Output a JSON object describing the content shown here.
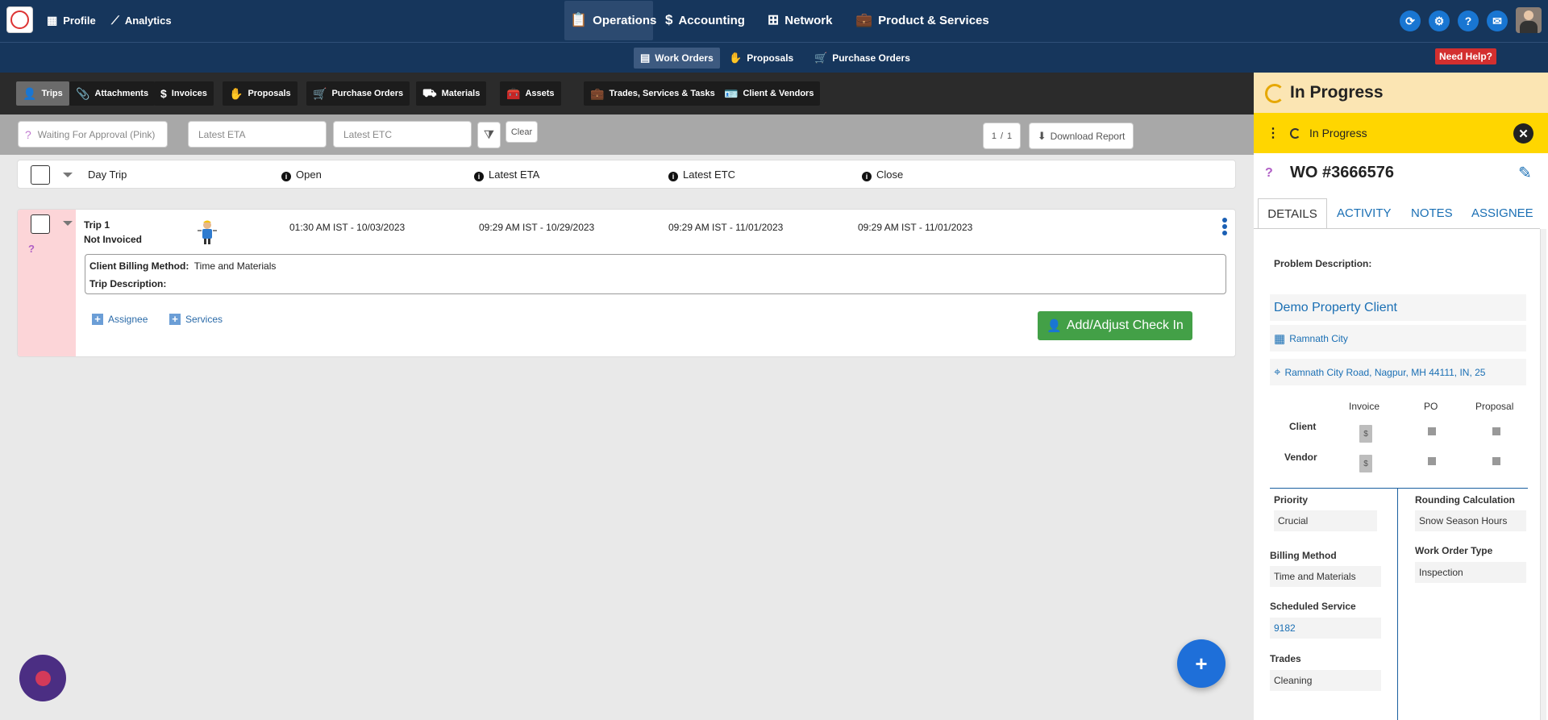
{
  "topnav": {
    "logo_text": "Logo",
    "left_items": [
      {
        "label": "Profile",
        "icon": "building-icon"
      },
      {
        "label": "Analytics",
        "icon": "chart-line-icon"
      }
    ],
    "center_items": [
      {
        "label": "Operations",
        "icon": "clipboard-icon",
        "active": true
      },
      {
        "label": "Accounting",
        "icon": "dollar-box-icon"
      },
      {
        "label": "Network",
        "icon": "network-icon"
      },
      {
        "label": "Product & Services",
        "icon": "briefcase-icon"
      }
    ],
    "right_icons": [
      "sync-icon",
      "gear-icon",
      "help-icon",
      "chat-icon"
    ]
  },
  "subnav": {
    "items": [
      {
        "label": "Work Orders",
        "active": true
      },
      {
        "label": "Proposals"
      },
      {
        "label": "Purchase Orders"
      }
    ],
    "need_help": "Need Help?"
  },
  "tabs": [
    "Trips",
    "Attachments",
    "Invoices",
    "Proposals",
    "Purchase Orders",
    "Materials",
    "Assets",
    "Trades, Services & Tasks",
    "Client & Vendors"
  ],
  "filters": {
    "status": "Waiting For Approval (Pink)",
    "eta_placeholder": "Latest ETA",
    "etc_placeholder": "Latest ETC",
    "clear": "Clear",
    "page_current": "1",
    "page_sep": "/",
    "page_total": "1",
    "download": "Download Report"
  },
  "table": {
    "headers": {
      "day_trip": "Day Trip",
      "open": "Open",
      "eta": "Latest ETA",
      "etc": "Latest ETC",
      "close": "Close"
    }
  },
  "trip": {
    "name": "Trip 1",
    "invoice_status": "Not Invoiced",
    "marker": "?",
    "open": "01:30 AM IST - 10/03/2023",
    "eta": "09:29 AM IST - 10/29/2023",
    "etc": "09:29 AM IST - 11/01/2023",
    "close": "09:29 AM IST - 11/01/2023",
    "billing_label": "Client Billing Method:",
    "billing_value": "Time and Materials",
    "description_label": "Trip Description:",
    "assignee": "Assignee",
    "services": "Services",
    "checkin": "Add/Adjust Check In"
  },
  "fab": "+",
  "panel": {
    "status_title": "In Progress",
    "status_bar": "In Progress",
    "wo_number": "WO #3666576",
    "tabs": [
      "DETAILS",
      "ACTIVITY",
      "NOTES",
      "ASSIGNEE"
    ],
    "problem_label": "Problem Description:",
    "client": "Demo Property Client",
    "location": "Ramnath City",
    "address": "Ramnath City Road, Nagpur, MH 44111, IN, 25",
    "matrix": {
      "cols": [
        "Invoice",
        "PO",
        "Proposal"
      ],
      "rows": [
        "Client",
        "Vendor"
      ]
    },
    "fields_left": [
      {
        "label": "Priority",
        "value": "Crucial"
      },
      {
        "label": "Billing Method",
        "value": "Time and Materials"
      },
      {
        "label": "Scheduled Service",
        "value": "9182"
      },
      {
        "label": "Trades",
        "value": "Cleaning"
      }
    ],
    "fields_right": [
      {
        "label": "Rounding Calculation",
        "value": "Snow Season Hours"
      },
      {
        "label": "Work Order Type",
        "value": "Inspection"
      }
    ]
  },
  "colors": {
    "nav": "#16365c",
    "status_top": "#fbe5b3",
    "status_bar": "#ffd600",
    "checkin": "#43a047",
    "fab": "#1e6fd9",
    "pink_row": "#fcd5d8"
  }
}
